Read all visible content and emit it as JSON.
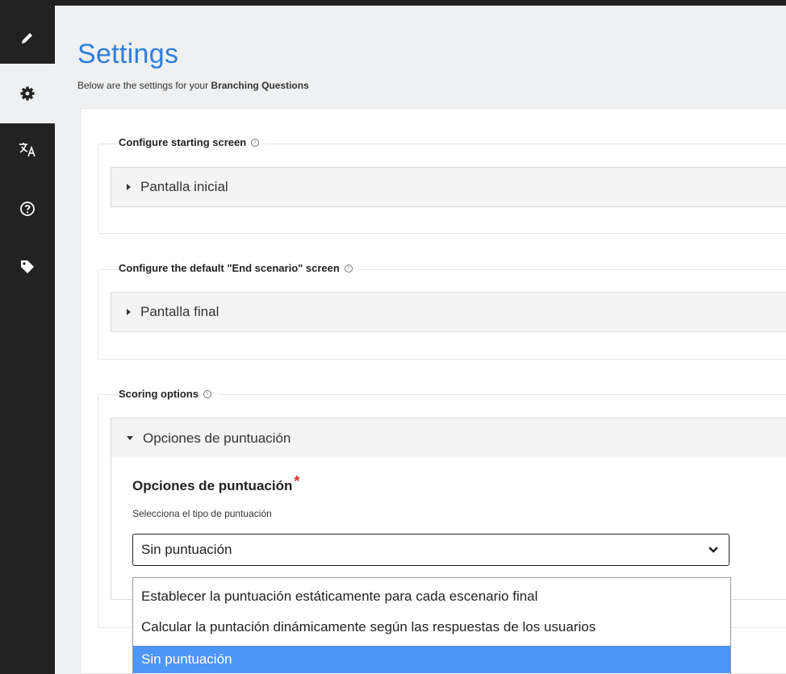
{
  "sidebar": {
    "items": [
      {
        "icon": "pencil-icon",
        "active": false
      },
      {
        "icon": "gear-icon",
        "active": true
      },
      {
        "icon": "translate-icon",
        "active": false
      },
      {
        "icon": "help-icon",
        "active": false
      },
      {
        "icon": "tag-icon",
        "active": false
      }
    ]
  },
  "header": {
    "title": "Settings",
    "subtitle_prefix": "Below are the settings for your ",
    "subtitle_bold": "Branching Questions"
  },
  "sections": {
    "start": {
      "legend": "Configure starting screen",
      "group_label": "Pantalla inicial"
    },
    "end": {
      "legend": "Configure the default \"End scenario\" screen",
      "group_label": "Pantalla final"
    },
    "scoring": {
      "legend": "Scoring options",
      "group_label": "Opciones de puntuación",
      "field_label": "Opciones de puntuación",
      "required_mark": "*",
      "field_description": "Selecciona el tipo de puntuación",
      "select_value": "Sin puntuación",
      "options": [
        "Establecer la puntuación estáticamente para cada escenario final",
        "Calcular la puntación dinámicamente según las respuestas de los usuarios",
        "Sin puntuación"
      ]
    }
  },
  "colors": {
    "accent": "#2f7ed8",
    "selected_option": "#4d95f7",
    "sidebar": "#222222",
    "required": "#d32f2f"
  }
}
